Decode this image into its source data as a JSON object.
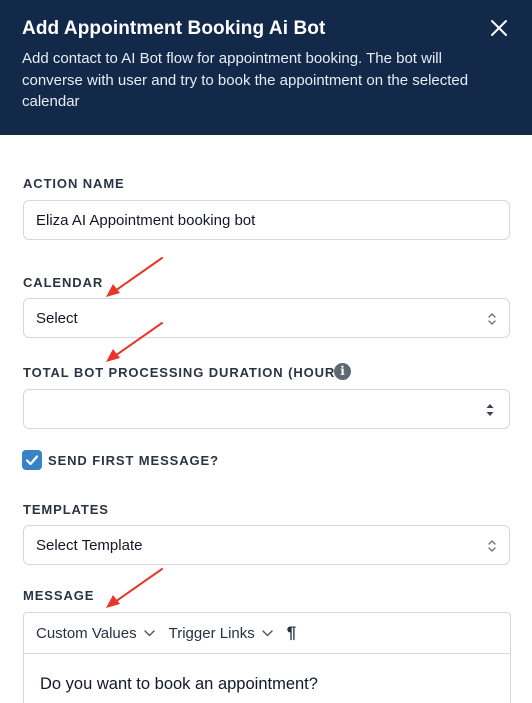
{
  "modal": {
    "title": "Add Appointment Booking Ai Bot",
    "subtitle": "Add contact to AI Bot flow for appointment booking. The bot will converse with user and try to book the appointment on the selected calendar"
  },
  "action_name": {
    "label": "ACTION NAME",
    "value": "Eliza AI Appointment booking bot"
  },
  "calendar": {
    "label": "CALENDAR",
    "selected": "Select"
  },
  "duration": {
    "label": "TOTAL BOT PROCESSING DURATION (HOURS)",
    "value": ""
  },
  "send_first_message": {
    "label": "SEND FIRST MESSAGE?",
    "checked": true
  },
  "templates": {
    "label": "TEMPLATES",
    "selected": "Select Template"
  },
  "message": {
    "label": "MESSAGE",
    "toolbar": {
      "custom_values": "Custom Values",
      "trigger_links": "Trigger Links",
      "paragraph": "¶"
    },
    "body": "Do you want to book an appointment?"
  },
  "colors": {
    "header_bg": "#12294a",
    "checkbox": "#3b82c4",
    "annotation_arrow": "#e8372a"
  },
  "icons": [
    "close-icon",
    "info-icon",
    "check-icon",
    "chevron-updown-icon",
    "spinner-icon",
    "chevron-down-icon",
    "pilcrow-icon",
    "arrow-annotation"
  ]
}
